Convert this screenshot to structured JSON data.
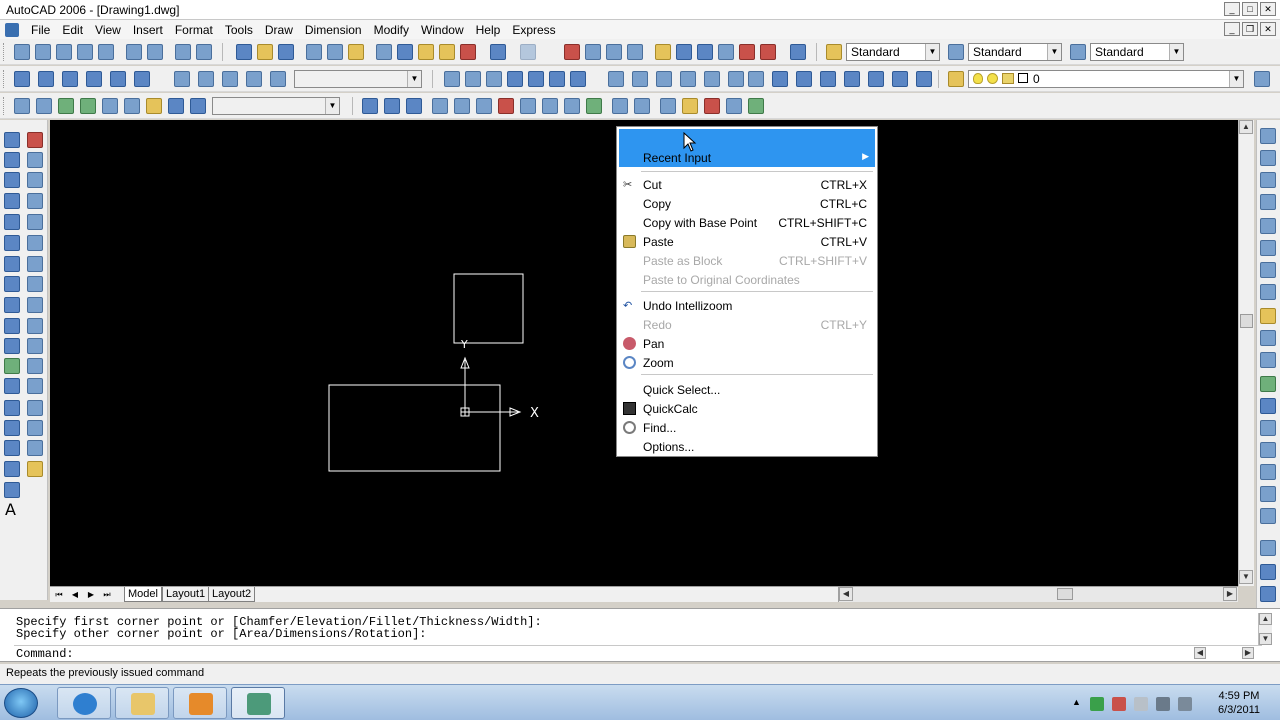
{
  "window": {
    "title": "AutoCAD 2006 - [Drawing1.dwg]",
    "controls": [
      "_",
      "□",
      "✕"
    ],
    "doc_controls": [
      "_",
      "❐",
      "✕"
    ]
  },
  "menubar": [
    "File",
    "Edit",
    "View",
    "Insert",
    "Format",
    "Tools",
    "Draw",
    "Dimension",
    "Modify",
    "Window",
    "Help",
    "Express"
  ],
  "toolbar1": {
    "text_style": "Standard",
    "dim_style": "Standard",
    "table_style": "Standard"
  },
  "toolbar2": {
    "layer": "0"
  },
  "canvas": {
    "ucs_x": "X",
    "ucs_y": "Y"
  },
  "tabs": {
    "nav": [
      "⏮",
      "◀",
      "▶",
      "⏭"
    ],
    "items": [
      "Model",
      "Layout1",
      "Layout2"
    ],
    "active": "Model"
  },
  "context_menu": {
    "recent_input": "Recent Input",
    "items": [
      {
        "label": "Cut",
        "shortcut": "CTRL+X",
        "icon": "scissors-icon",
        "enabled": true
      },
      {
        "label": "Copy",
        "shortcut": "CTRL+C",
        "icon": "",
        "enabled": true
      },
      {
        "label": "Copy with Base Point",
        "shortcut": "CTRL+SHIFT+C",
        "icon": "",
        "enabled": true
      },
      {
        "label": "Paste",
        "shortcut": "CTRL+V",
        "icon": "clipboard-icon",
        "enabled": true
      },
      {
        "label": "Paste as Block",
        "shortcut": "CTRL+SHIFT+V",
        "icon": "",
        "enabled": false
      },
      {
        "label": "Paste to Original Coordinates",
        "shortcut": "",
        "icon": "",
        "enabled": false
      },
      {
        "label": "Undo Intellizoom",
        "shortcut": "",
        "icon": "undo-icon",
        "enabled": true
      },
      {
        "label": "Redo",
        "shortcut": "CTRL+Y",
        "icon": "",
        "enabled": false
      },
      {
        "label": "Pan",
        "shortcut": "",
        "icon": "pan-icon",
        "enabled": true
      },
      {
        "label": "Zoom",
        "shortcut": "",
        "icon": "zoom-icon",
        "enabled": true
      },
      {
        "label": "Quick Select...",
        "shortcut": "",
        "icon": "",
        "enabled": true
      },
      {
        "label": "QuickCalc",
        "shortcut": "",
        "icon": "calculator-icon",
        "enabled": true
      },
      {
        "label": "Find...",
        "shortcut": "",
        "icon": "find-icon",
        "enabled": true
      },
      {
        "label": "Options...",
        "shortcut": "",
        "icon": "",
        "enabled": true
      }
    ]
  },
  "command": {
    "line1": "Specify first corner point or [Chamfer/Elevation/Fillet/Thickness/Width]:",
    "line2": "Specify other corner point or [Area/Dimensions/Rotation]:",
    "prompt": "Command:"
  },
  "status": {
    "text": "Repeats the previously issued command"
  },
  "taskbar": {
    "time": "4:59 PM",
    "date": "6/3/2011"
  }
}
